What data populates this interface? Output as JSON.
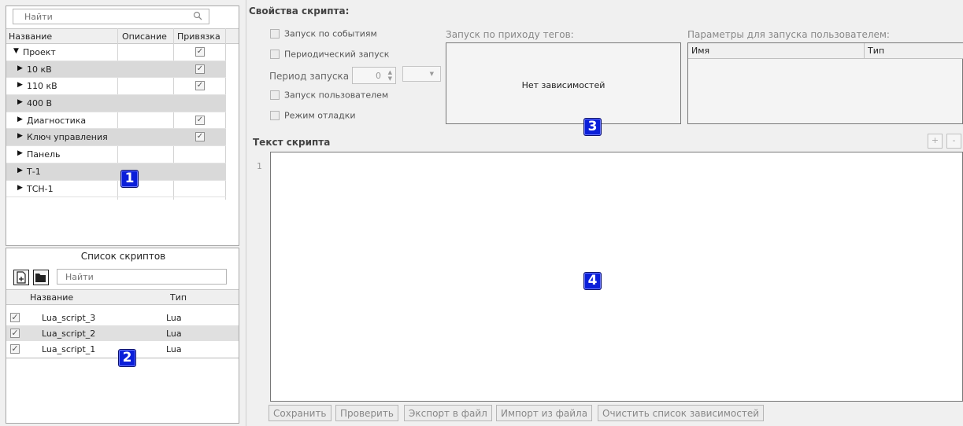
{
  "tree": {
    "search_placeholder": "Найти",
    "columns": [
      "Название",
      "Описание",
      "Привязка"
    ],
    "rows": [
      {
        "label": "Проект",
        "expanded": true,
        "bound": true
      },
      {
        "label": "10 кВ",
        "expanded": false,
        "bound": true
      },
      {
        "label": "110 кВ",
        "expanded": false,
        "bound": true
      },
      {
        "label": "400 В",
        "expanded": false,
        "bound": false
      },
      {
        "label": "Диагностика",
        "expanded": false,
        "bound": true
      },
      {
        "label": "Ключ управления",
        "expanded": false,
        "bound": true
      },
      {
        "label": "Панель",
        "expanded": false,
        "bound": false
      },
      {
        "label": "Т-1",
        "expanded": false,
        "bound": false
      },
      {
        "label": "ТСН-1",
        "expanded": false,
        "bound": false
      }
    ]
  },
  "scripts": {
    "title": "Список скриптов",
    "search_placeholder": "Найти",
    "columns": [
      "Название",
      "Тип"
    ],
    "rows": [
      {
        "name": "Lua_script_3",
        "type": "Lua",
        "checked": true
      },
      {
        "name": "Lua_script_2",
        "type": "Lua",
        "checked": true
      },
      {
        "name": "Lua_script_1",
        "type": "Lua",
        "checked": true
      }
    ]
  },
  "props": {
    "title": "Свойства скрипта:",
    "event_run": "Запуск по событиям",
    "periodic_run": "Периодический запуск",
    "period_label": "Период запуска",
    "period_value": "0",
    "user_run": "Запуск пользователем",
    "debug_mode": "Режим отладки",
    "tags_label": "Запуск по приходу тегов:",
    "tags_empty": "Нет зависимостей",
    "params_label": "Параметры для запуска пользователем:",
    "params_columns": [
      "Имя",
      "Тип"
    ]
  },
  "editor": {
    "title": "Текст скрипта",
    "line_number": "1",
    "add_label": "+",
    "remove_label": "-"
  },
  "buttons": {
    "save": "Сохранить",
    "check": "Проверить",
    "export": "Экспорт в файл",
    "import": "Импорт из файла",
    "clear": "Очистить список зависимостей"
  },
  "markers": [
    "1",
    "2",
    "3",
    "4"
  ],
  "colors": {
    "marker": "#0b1fd9",
    "row_alt": "#d9d9d9"
  }
}
